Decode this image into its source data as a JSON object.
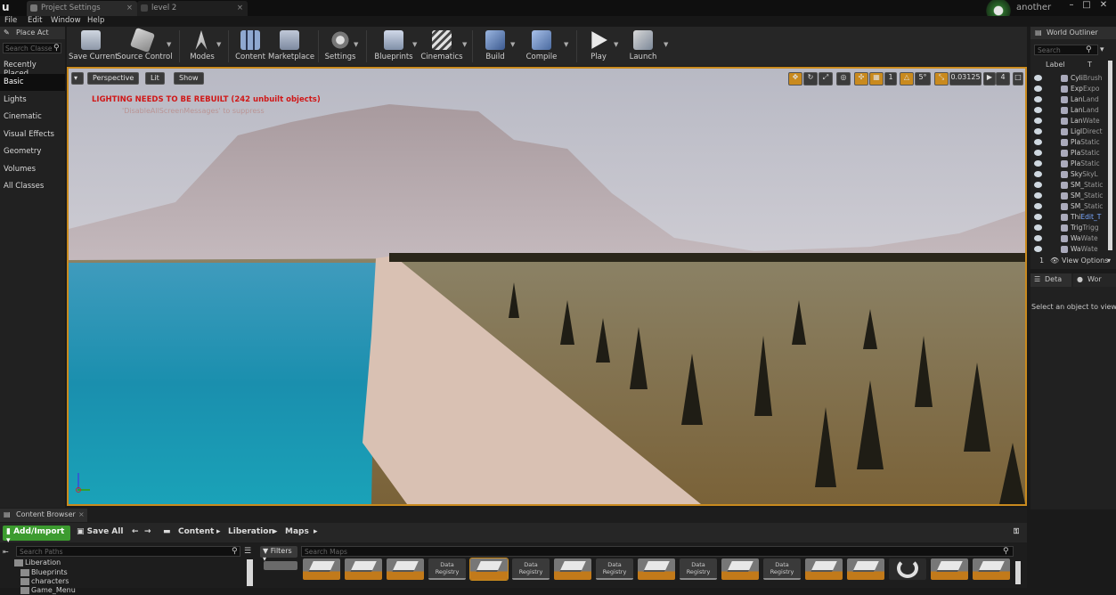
{
  "titlebar": {
    "tabs": [
      {
        "label": "Project Settings"
      },
      {
        "label": "level 2"
      }
    ],
    "user": "another"
  },
  "menubar": [
    "File",
    "Edit",
    "Window",
    "Help"
  ],
  "place_actors": {
    "title": "Place Act",
    "search_placeholder": "Search Classe",
    "categories": [
      "Recently Placed",
      "Basic",
      "Lights",
      "Cinematic",
      "Visual Effects",
      "Geometry",
      "Volumes",
      "All Classes"
    ],
    "active_category": "Basic"
  },
  "toolbar": {
    "items": [
      {
        "label": "Save Current",
        "icon": "save-icon"
      },
      {
        "label": "Source Control",
        "icon": "source-control-icon"
      },
      {
        "label": "Modes",
        "icon": "modes-icon"
      },
      {
        "label": "Content",
        "icon": "content-icon"
      },
      {
        "label": "Marketplace",
        "icon": "marketplace-icon"
      },
      {
        "label": "Settings",
        "icon": "settings-icon"
      },
      {
        "label": "Blueprints",
        "icon": "blueprints-icon"
      },
      {
        "label": "Cinematics",
        "icon": "cinematics-icon"
      },
      {
        "label": "Build",
        "icon": "build-icon"
      },
      {
        "label": "Compile",
        "icon": "compile-icon"
      },
      {
        "label": "Play",
        "icon": "play-icon"
      },
      {
        "label": "Launch",
        "icon": "launch-icon"
      }
    ]
  },
  "viewport": {
    "perspective": "Perspective",
    "lit": "Lit",
    "show": "Show",
    "warning": "LIGHTING NEEDS TO BE REBUILT (242 unbuilt objects)",
    "suppress_hint": "'DisableAllScreenMessages' to suppress",
    "rotation_snap": "5°",
    "scale_snap": "0.03125",
    "camera_speed": "4",
    "grid_snap": "1"
  },
  "outliner": {
    "title": "World Outliner",
    "search_placeholder": "Search",
    "col_label": "Label",
    "col_type": "T",
    "rows": [
      {
        "name": "Cyli",
        "type": "Brush"
      },
      {
        "name": "Exp",
        "type": "Expo"
      },
      {
        "name": "Lan",
        "type": "Land"
      },
      {
        "name": "Lan",
        "type": "Land"
      },
      {
        "name": "Lan",
        "type": "Wate"
      },
      {
        "name": "Ligl",
        "type": "Direct"
      },
      {
        "name": "Pla",
        "type": "Static"
      },
      {
        "name": "Pla",
        "type": "Static"
      },
      {
        "name": "Pla",
        "type": "Static"
      },
      {
        "name": "Sky",
        "type": "SkyL"
      },
      {
        "name": "SM_",
        "type": "Static"
      },
      {
        "name": "SM_",
        "type": "Static"
      },
      {
        "name": "SM_",
        "type": "Static"
      },
      {
        "name": "Thi",
        "type": "Edit_T"
      },
      {
        "name": "Trig",
        "type": "Trigg"
      },
      {
        "name": "Wa",
        "type": "Wate"
      },
      {
        "name": "Wa",
        "type": "Wate"
      }
    ],
    "count": "1",
    "view_options": "View Options"
  },
  "details": {
    "tab1": "Deta",
    "tab2": "Wor",
    "message": "Select an object to view de"
  },
  "content_browser": {
    "title": "Content Browser",
    "add_import": "Add/Import",
    "save_all": "Save All",
    "breadcrumb": [
      "Content",
      "Liberation",
      "Maps"
    ],
    "paths_placeholder": "Search Paths",
    "tree": [
      "Liberation",
      "Blueprints",
      "characters",
      "Game_Menu"
    ],
    "filters": "Filters",
    "maps_placeholder": "Search Maps",
    "data_registry_label": "Data Registry"
  },
  "colors": {
    "accent": "#c98a1e",
    "add_button": "#3c9b2f",
    "warning": "#d01818"
  }
}
